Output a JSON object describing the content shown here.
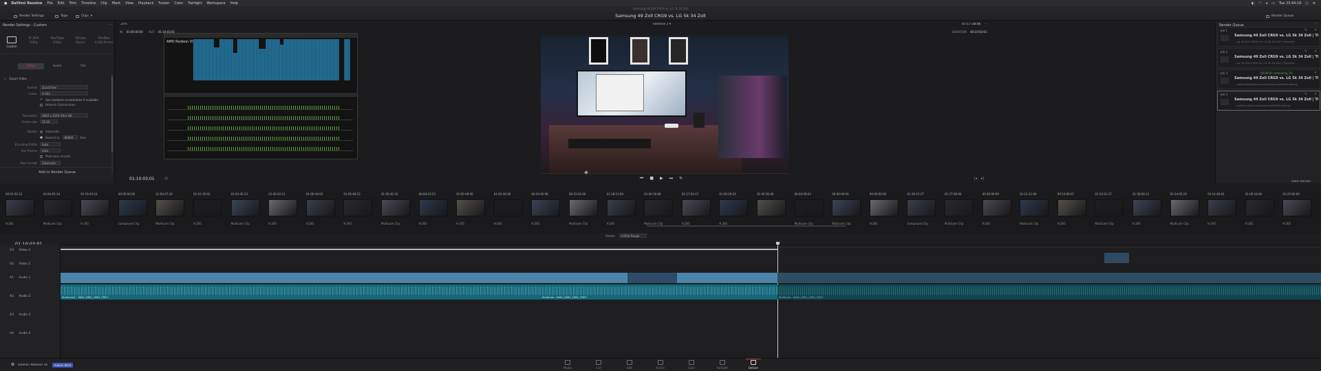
{
  "menubar": {
    "app": "DaVinci Resolve",
    "items": [
      "File",
      "Edit",
      "Trim",
      "Timeline",
      "Clip",
      "Mark",
      "View",
      "Playback",
      "Fusion",
      "Color",
      "Fairlight",
      "Workspace",
      "Help"
    ],
    "clock": "Tue 23:44:16"
  },
  "window_title": "Samsung 49 Zoll CRG9 vs. LG 5k 34 Zoll",
  "toolbar": {
    "render_settings": "Render Settings",
    "tape": "Tape",
    "clips": "Clips",
    "timeline_name": "Timeline 1",
    "render_queue": "Render Queue",
    "zoom": "20%",
    "duration_left": "07:17:58:06"
  },
  "render_settings": {
    "title": "Render Settings - Custom",
    "presets": [
      "Custom",
      "H.264",
      "YouTube",
      "Vimeo",
      "ProRes"
    ],
    "preset_subs": [
      "Custom",
      "1080p",
      "1080p",
      "Master",
      "H.264 Master"
    ],
    "tabs": [
      "Video",
      "Audio",
      "File"
    ],
    "export_video": "Export Video",
    "format_label": "Format",
    "format_value": "QuickTime",
    "codec_label": "Codec",
    "codec_value": "H.264",
    "hw_accel": "Use hardware acceleration if available",
    "network_opt": "Network Optimization",
    "resolution_label": "Resolution",
    "resolution_value": "3840 x 2160 Ultra HD",
    "framerate_label": "Frame rate",
    "framerate_value": "25.00",
    "quality_label": "Quality",
    "quality_auto": "Automatic",
    "quality_restrict": "Restrict to",
    "quality_value": "80000",
    "quality_unit": "Kb/s",
    "encoding_profile_label": "Encoding Profile",
    "encoding_profile_value": "Auto",
    "keyframes_label": "Key Frames",
    "keyframes_value": "Auto",
    "multi_pass": "Multi-pass encode",
    "pixel_format_label": "Pixel Format",
    "pixel_format_value": "Automatic",
    "add_to_queue": "Add to Render Queue"
  },
  "viewer": {
    "in_tc": "01:00:00:00",
    "out_tc": "01:10:03:01",
    "cpu_label": "AMD Radeon VII",
    "current_tc": "01:10:03;01",
    "duration_label": "DURATION",
    "duration_value": "00:10:03:01"
  },
  "render_queue": {
    "title": "Render Queue",
    "jobs": [
      {
        "id": "Job 1",
        "title": "Samsung 49 Zoll CRG9 vs. LG 5k 34 Zoll | Ti...",
        "sub": "...ng 49 Zoll CRG9 vs. LG 5k 34 Zoll | Timeline",
        "status": ""
      },
      {
        "id": "Job 2",
        "title": "Samsung 49 Zoll CRG9 vs. LG 5k 34 Zoll | Ti...",
        "sub": "...ng 49 Zoll CRG9 vs. LG 5k 34 Zoll | Timeline",
        "status": ""
      },
      {
        "id": "Job 3",
        "title": "Samsung 49 Zoll CRG9 vs. LG 5k 34 Zoll | Ti...",
        "sub": "...co/Desktop/Samsung49/Samsung49Rendering",
        "status": "00:00:01 remaining 1%"
      },
      {
        "id": "Job 4",
        "title": "Samsung 49 Zoll CRG9 vs. LG 5k 34 Zoll | Ti...",
        "sub": "...ts/Marco/Desktop/Samsung49/Rendering",
        "status": ""
      }
    ],
    "start_render": "Start Render"
  },
  "clips": {
    "top": [
      "00:01:02:13",
      "01:04:05:14",
      "01:19:45:10",
      "00:00:00:00",
      "01:04:47:20",
      "01:01:19:02",
      "01:02:45:23",
      "01:00:42:12",
      "01:06:48:00",
      "01:05:48:22",
      "01:00:45:10",
      "00:00:23:23",
      "01:00:08:00",
      "01:02:46:36",
      "00:24:06:06",
      "00:23:42:00",
      "01:18:11:00",
      "01:00:16:06",
      "01:17:01:07",
      "01:06:29:24",
      "01:02:36:00",
      "00:04:59:02",
      "00:00:00:00",
      "00:00:00:00",
      "01:16:15:27",
      "01:27:08:00",
      "00:00:00:00",
      "01:11:11:00",
      "00:14:06:07",
      "01:24:21:17",
      "01:28:00:12",
      "01:24:45:20",
      "01:14:46:02",
      "01:00:16:00",
      "01:25:00:00"
    ],
    "bottom": [
      "H.265",
      "Multicam Clip",
      "H.265",
      "Compound Clip",
      "Multicam Clip",
      "H.265",
      "Multicam Clip",
      "H.265",
      "H.265",
      "H.265",
      "Multicam Clip",
      "H.265",
      "H.265",
      "H.265",
      "H.265",
      "Multicam Clip",
      "H.265",
      "Multicam Clip",
      "H.265",
      "H.265",
      "",
      "Multicam Clip",
      "Multicam Clip",
      "H.265",
      "Compound Clip",
      "Multicam Clip",
      "H.265",
      "Multicam Clip",
      "H.265",
      "Multicam Clip",
      "H.265",
      "Multicam Clip",
      "H.265",
      "H.265",
      "H.265"
    ]
  },
  "timeline": {
    "timecode": "01:10:03;01",
    "render_label": "Render",
    "render_value": "In/Out Range",
    "tracks": [
      {
        "id": "V3",
        "name": "Video 3"
      },
      {
        "id": "V2",
        "name": "Video 2"
      },
      {
        "id": "A1",
        "name": "Audio 1"
      },
      {
        "id": "A2",
        "name": "Audio 2"
      },
      {
        "id": "A3",
        "name": "Audio 3"
      },
      {
        "id": "A4",
        "name": "Audio 4"
      }
    ],
    "audio_clip_1": "Multicam1 - MAH_1881_1881_TREY",
    "audio_clip_2": "Multicam - MAH_1881_1881_TREY",
    "audio_clip_3": "Multicam - MAH_1881_1881_TREY"
  },
  "bottom": {
    "app": "DaVinci Resolve 16",
    "badge": "PUBLIC BETA",
    "pages": [
      "Media",
      "Cut",
      "Edit",
      "Fusion",
      "Color",
      "Fairlight",
      "Deliver"
    ]
  },
  "colors": {
    "accent": "#e0393b",
    "timeline_video": "#4b85ac",
    "timeline_audio": "#14687a",
    "active_tab": "#3a3b40"
  }
}
